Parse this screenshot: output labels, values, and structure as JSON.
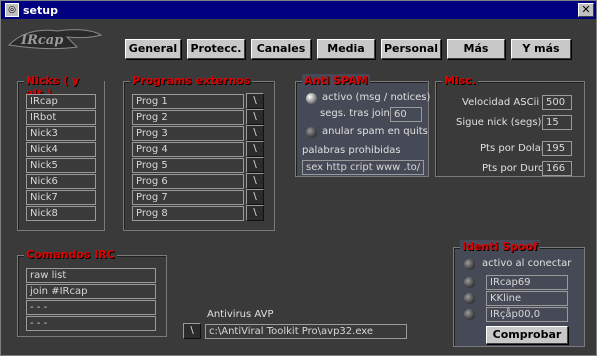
{
  "window": {
    "title": "setup",
    "close_glyph": "✕"
  },
  "logo": {
    "text": "IRcap"
  },
  "tabs": [
    {
      "label": "General"
    },
    {
      "label": "Protecc."
    },
    {
      "label": "Canales"
    },
    {
      "label": "Media"
    },
    {
      "label": "Personal"
    },
    {
      "label": "Más"
    },
    {
      "label": "Y más"
    }
  ],
  "nicks": {
    "title": "Nicks ( y alt.)",
    "items": [
      "IRcap",
      "IRbot",
      "Nick3",
      "Nick4",
      "Nick5",
      "Nick6",
      "Nick7",
      "Nick8"
    ]
  },
  "programs": {
    "title": "Programs externos",
    "items": [
      "Prog 1",
      "Prog 2",
      "Prog 3",
      "Prog 4",
      "Prog 5",
      "Prog 6",
      "Prog 7",
      "Prog 8"
    ],
    "browse_label": "\\"
  },
  "antispam": {
    "title": "Anti SPAM",
    "activo_label": "activo (msg / notices)",
    "segs_label": "segs. tras join",
    "segs_value": "60",
    "anular_label": "anular spam en quits",
    "palabras_label": "palabras prohibidas",
    "palabras_value": "sex http cript www .to/"
  },
  "misc": {
    "title": "Misc.",
    "rows": [
      {
        "label": "Velocidad ASCii",
        "value": "500"
      },
      {
        "label": "Sigue nick (segs)",
        "value": "15"
      },
      {
        "label": "Pts por Dolar",
        "value": "195"
      },
      {
        "label": "Pts por Duro",
        "value": "166"
      }
    ]
  },
  "commands": {
    "title": "Comandos IRC",
    "items": [
      "raw list",
      "join #IRcap",
      "- - -",
      "- - -"
    ]
  },
  "antivirus": {
    "label": "Antivirus AVP",
    "path": "c:\\AntiViral Toolkit Pro\\avp32.exe",
    "browse_label": "\\"
  },
  "ident": {
    "title": "Identi Spoof",
    "connect_label": "activo al conectar",
    "options": [
      "IRcap69",
      "KKline",
      "IRçåp00,0"
    ],
    "check_button": "Comprobar"
  }
}
